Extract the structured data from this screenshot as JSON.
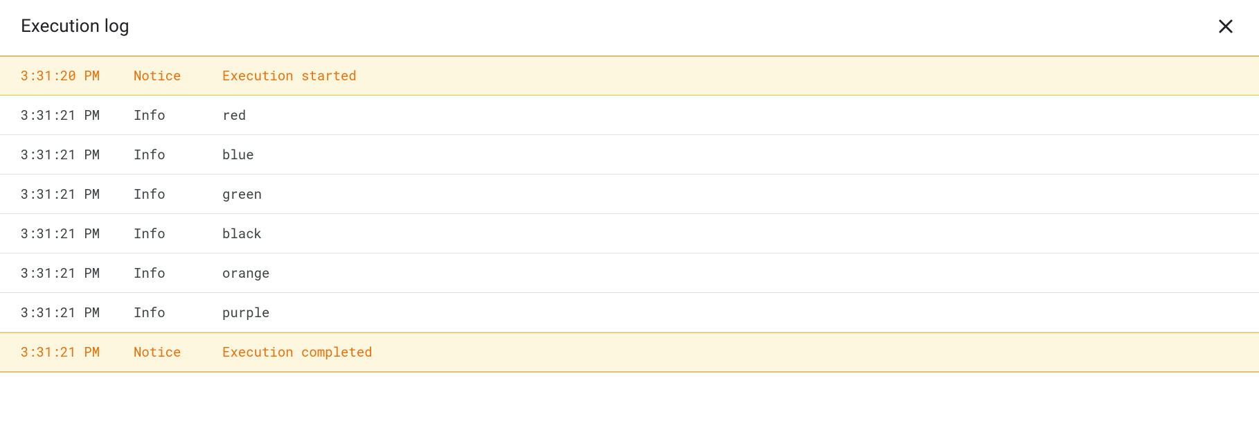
{
  "header": {
    "title": "Execution log"
  },
  "log": {
    "rows": [
      {
        "time": "3:31:20 PM",
        "level": "Notice",
        "message": "Execution started",
        "type": "notice"
      },
      {
        "time": "3:31:21 PM",
        "level": "Info",
        "message": "red",
        "type": "info"
      },
      {
        "time": "3:31:21 PM",
        "level": "Info",
        "message": "blue",
        "type": "info"
      },
      {
        "time": "3:31:21 PM",
        "level": "Info",
        "message": "green",
        "type": "info"
      },
      {
        "time": "3:31:21 PM",
        "level": "Info",
        "message": "black",
        "type": "info"
      },
      {
        "time": "3:31:21 PM",
        "level": "Info",
        "message": "orange",
        "type": "info"
      },
      {
        "time": "3:31:21 PM",
        "level": "Info",
        "message": "purple",
        "type": "info"
      },
      {
        "time": "3:31:21 PM",
        "level": "Notice",
        "message": "Execution completed",
        "type": "notice"
      }
    ]
  }
}
